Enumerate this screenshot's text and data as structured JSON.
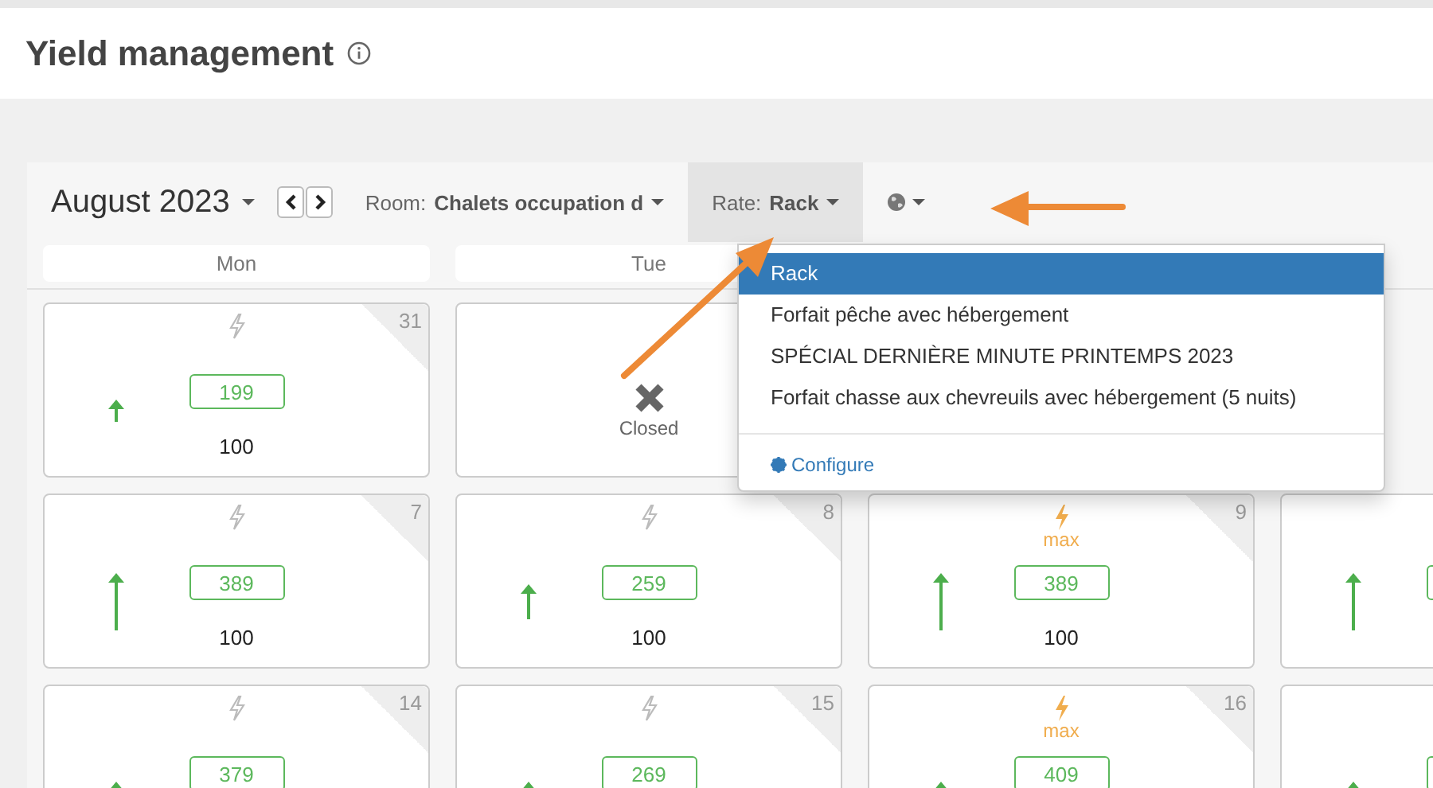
{
  "page": {
    "title": "Yield management"
  },
  "toolbar": {
    "month": "August 2023",
    "room_label": "Room:",
    "room_value": "Chalets occupation d",
    "rate_label": "Rate:",
    "rate_value": "Rack",
    "rate_open": true
  },
  "rate_menu": {
    "items": [
      {
        "label": "Rack",
        "selected": true
      },
      {
        "label": "Forfait pêche avec hébergement",
        "selected": false
      },
      {
        "label": "SPÉCIAL DERNIÈRE MINUTE PRINTEMPS 2023",
        "selected": false
      },
      {
        "label": "Forfait chasse aux chevreuils avec hébergement (5 nuits)",
        "selected": false
      }
    ],
    "configure": "Configure"
  },
  "weekdays": [
    {
      "label": "Mon"
    },
    {
      "label": "Tue"
    }
  ],
  "weeks": [
    {
      "cells": [
        {
          "kind": "rate",
          "day": "31",
          "max": false,
          "price": "199",
          "occupancy": "100"
        },
        {
          "kind": "closed",
          "label": "Closed"
        }
      ]
    },
    {
      "cells": [
        {
          "kind": "rate",
          "day": "7",
          "max": false,
          "price": "389",
          "occupancy": "100"
        },
        {
          "kind": "rate",
          "day": "8",
          "max": false,
          "price": "259",
          "occupancy": "100"
        },
        {
          "kind": "rate",
          "day": "9",
          "max": true,
          "max_label": "max",
          "price": "389",
          "occupancy": "100"
        },
        {
          "kind": "partial"
        }
      ]
    },
    {
      "cells": [
        {
          "kind": "rate",
          "day": "14",
          "max": false,
          "price": "379"
        },
        {
          "kind": "rate",
          "day": "15",
          "max": false,
          "price": "269"
        },
        {
          "kind": "rate",
          "day": "16",
          "max": true,
          "max_label": "max",
          "price": "409"
        },
        {
          "kind": "partial"
        }
      ]
    }
  ]
}
